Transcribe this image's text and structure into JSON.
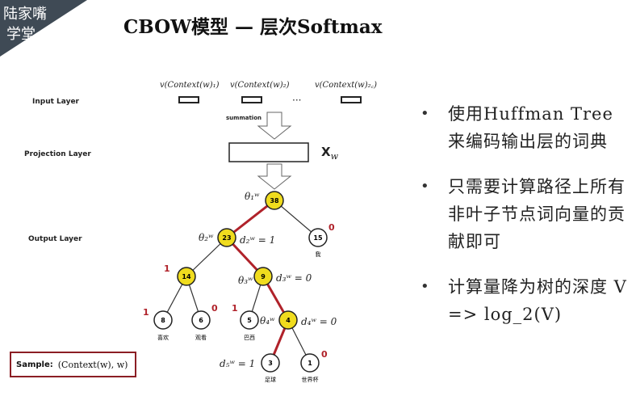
{
  "slide": {
    "corner_logo": {
      "line1": "陆家嘴",
      "line2": "学堂",
      "color": "#3f4a55"
    },
    "title": "CBOW模型 — 层次Softmax",
    "diagram": {
      "layers": {
        "input": "Input Layer",
        "projection": "Projection Layer",
        "output": "Output Layer"
      },
      "context_vectors": [
        "v(Context(w)₁)",
        "v(Context(w)₂)",
        "v(Context(w)₂꜀)"
      ],
      "ellipsis": "···",
      "summation_label": "summation",
      "projection_vector": "X",
      "projection_subscript": "w",
      "nodes": [
        {
          "id": "n38",
          "value": "38",
          "on_path": true
        },
        {
          "id": "n23",
          "value": "23",
          "on_path": true
        },
        {
          "id": "n15",
          "value": "15",
          "on_path": false,
          "word": "我"
        },
        {
          "id": "n14",
          "value": "14",
          "on_path": false
        },
        {
          "id": "n9",
          "value": "9",
          "on_path": true
        },
        {
          "id": "n8",
          "value": "8",
          "on_path": false,
          "word": "喜欢"
        },
        {
          "id": "n6",
          "value": "6",
          "on_path": false,
          "word": "观看"
        },
        {
          "id": "n5",
          "value": "5",
          "on_path": false,
          "word": "巴西"
        },
        {
          "id": "n4",
          "value": "4",
          "on_path": true
        },
        {
          "id": "n3",
          "value": "3",
          "on_path": false,
          "word": "足球"
        },
        {
          "id": "n1",
          "value": "1",
          "on_path": false,
          "word": "世界杯"
        }
      ],
      "theta_labels": [
        "θ₁ʷ",
        "θ₂ʷ",
        "θ₃ʷ",
        "θ₄ʷ"
      ],
      "d_labels": [
        "d₂ʷ = 1",
        "d₃ʷ = 0",
        "d₄ʷ = 0",
        "d₅ʷ = 1"
      ],
      "edge_codes": {
        "left": "1",
        "right": "0"
      },
      "colors": {
        "path": "#b0222a",
        "highlight_node": "#f0dc1e",
        "code": "#b0222a"
      }
    },
    "sample": {
      "label": "Sample:",
      "value": "(Context(w), w)"
    },
    "bullets": [
      "使用Huffman Tree来编码输出层的词典",
      "只需要计算路径上所有非叶子节点词向量的贡献即可",
      "计算量降为树的深度 V => log_2(V)"
    ]
  }
}
